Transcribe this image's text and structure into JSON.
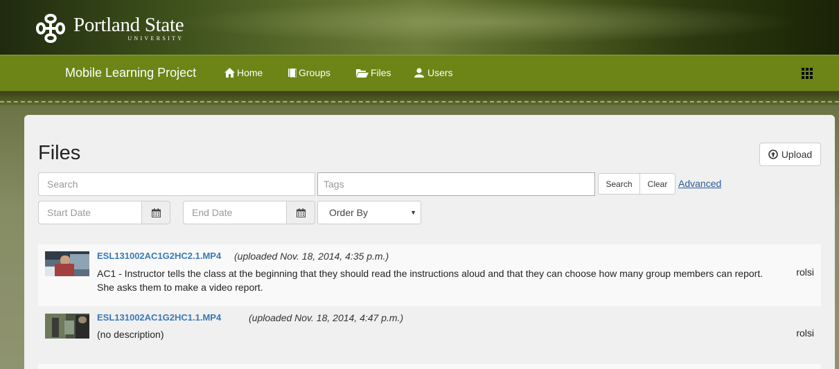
{
  "header": {
    "logo_name": "Portland State",
    "logo_sub": "UNIVERSITY"
  },
  "nav": {
    "brand": "Mobile Learning Project",
    "items": [
      {
        "label": "Home",
        "icon": "home-icon"
      },
      {
        "label": "Groups",
        "icon": "book-icon"
      },
      {
        "label": "Files",
        "icon": "folder-open-icon"
      },
      {
        "label": "Users",
        "icon": "user-icon"
      }
    ],
    "apps_icon": "grid-icon"
  },
  "main": {
    "title": "Files",
    "upload_label": "Upload",
    "search": {
      "placeholder": "Search",
      "value": ""
    },
    "tags": {
      "placeholder": "Tags",
      "value": ""
    },
    "search_button": "Search",
    "clear_button": "Clear",
    "advanced_link": "Advanced",
    "start_date": {
      "placeholder": "Start Date"
    },
    "end_date": {
      "placeholder": "End Date"
    },
    "order_by": {
      "selected": "Order By"
    }
  },
  "files": [
    {
      "name": "ESL131002AC1G2HC2.1.MP4",
      "uploaded": "(uploaded Nov. 18, 2014, 4:35 p.m.)",
      "description_line1": "AC1 - Instructor tells the class at the beginning that they should read the instructions aloud and that they can choose how many group members can report.",
      "description_line2": "She asks them to make a video report.",
      "owner": "rolsi"
    },
    {
      "name": "ESL131002AC1G2HC1.1.MP4",
      "uploaded": "(uploaded Nov. 18, 2014, 4:47 p.m.)",
      "description_line1": "(no description)",
      "owner": "rolsi"
    }
  ],
  "colors": {
    "nav_bg": "#6c8516",
    "link": "#3879b6",
    "panel_bg": "#f0f0f0"
  }
}
